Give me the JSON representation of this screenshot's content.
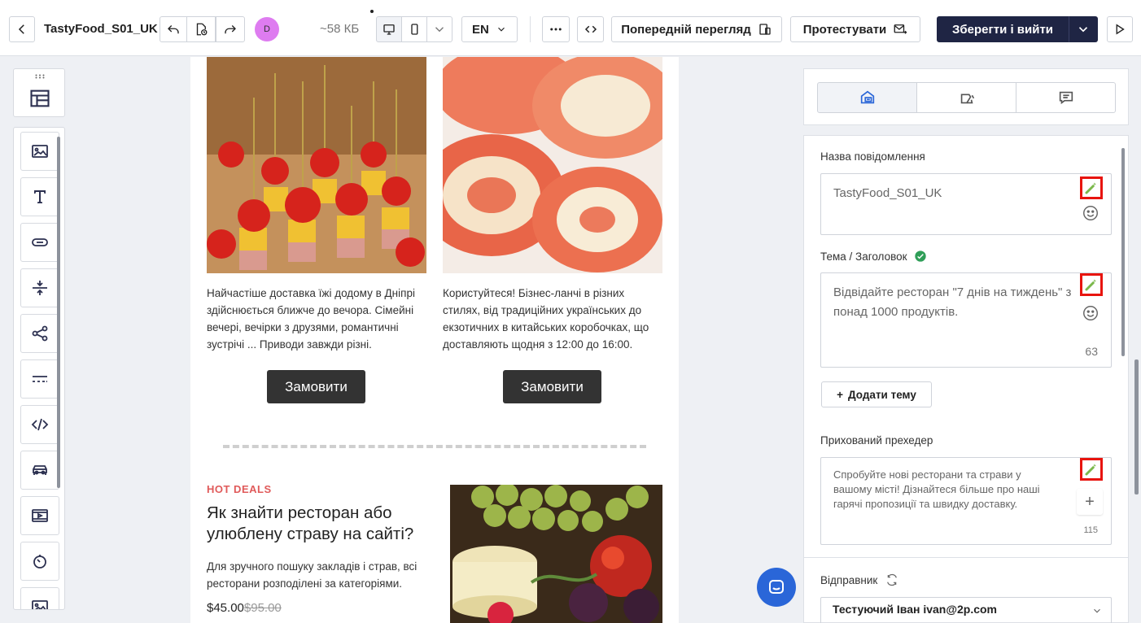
{
  "header": {
    "title": "TastyFood_S01_UK",
    "size": "~58 КБ",
    "avatar_letter": "D",
    "language": "EN",
    "preview_label": "Попередній перегляд",
    "test_label": "Протестувати",
    "save_label": "Зберегти і вийти"
  },
  "left_toolbar": {
    "tools": [
      "layout-icon",
      "image-icon",
      "text-icon",
      "button-icon",
      "spacer-icon",
      "social-icon",
      "divider-icon",
      "html-icon",
      "product-icon",
      "video-icon",
      "timer-icon",
      "image-icon"
    ]
  },
  "email": {
    "blocks": [
      {
        "description": "Найчастіше доставка їжі додому в Дніпрі здійснюється ближче до вечора. Сімейні вечері, вечірки з друзями, романтичні зустрічі ... Приводи завжди різні.",
        "button": "Замовити"
      },
      {
        "description": "Користуйтеся! Бізнес-ланчі в різних стилях, від традиційних українських до екзотичних в китайських коробочках, що доставляють щодня з 12:00 до 16:00.",
        "button": "Замовити"
      }
    ],
    "hot": {
      "tag": "HOT DEALS",
      "title": "Як знайти ресторан або улюблену страву на сайті?",
      "text": "Для зручного пошуку закладів і страв, всі ресторани розподілені за категоріями.",
      "price": "$45.00",
      "old_price": "$95.00"
    }
  },
  "panel": {
    "message_name_label": "Назва повідомлення",
    "message_name_value": "TastyFood_S01_UK",
    "subject_label": "Тема / Заголовок",
    "subject_value": "Відвідайте ресторан \"7 днів на тиждень\" з понад 1000 продуктів.",
    "subject_count": "63",
    "add_theme_label": "Додати тему",
    "preheader_label": "Прихований прехедер",
    "preheader_value": "Спробуйте нові ресторани та страви у вашому місті! Дізнайтеся більше про наші гарячі пропозиції та швидку доставку.",
    "preheader_count": "115",
    "sender_label": "Відправник",
    "sender_value": "Тестуючий Іван ivan@2p.com"
  },
  "colors": {
    "accent": "#2a66d8",
    "dark_button": "#1f2544",
    "ai_highlight": "#e8140e",
    "hot_deals": "#e05a5a",
    "avatar": "#de7cf0"
  }
}
